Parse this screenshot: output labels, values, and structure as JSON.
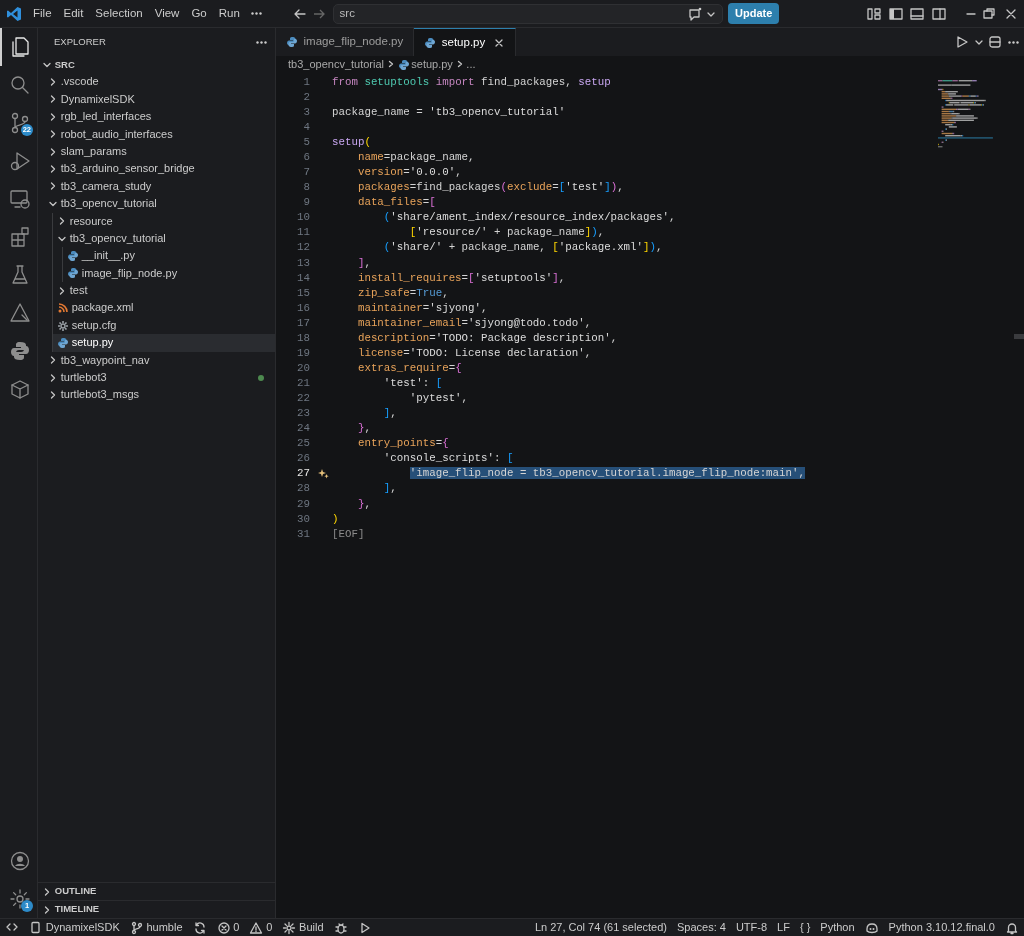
{
  "title_bar": {
    "menus": [
      "File",
      "Edit",
      "Selection",
      "View",
      "Go",
      "Run"
    ],
    "command_center": {
      "value": "src"
    },
    "update_button": "Update"
  },
  "activity_bar": {
    "top": [
      {
        "kind": "files",
        "selected": true
      },
      {
        "kind": "search",
        "selected": false
      },
      {
        "kind": "source-control",
        "selected": false,
        "badge": "22"
      },
      {
        "kind": "run-debug",
        "selected": false
      },
      {
        "kind": "remote",
        "selected": false
      },
      {
        "kind": "extensions",
        "selected": false
      },
      {
        "kind": "flask",
        "selected": false
      },
      {
        "kind": "tool",
        "selected": false
      },
      {
        "kind": "python",
        "selected": false
      },
      {
        "kind": "cube",
        "selected": false
      }
    ],
    "bottom": [
      {
        "kind": "account",
        "selected": false
      },
      {
        "kind": "settings",
        "selected": false,
        "badge": "1"
      }
    ]
  },
  "sidebar": {
    "title": "EXPLORER",
    "root": {
      "label": "SRC",
      "expanded": true
    },
    "tree": [
      {
        "label": ".vscode",
        "kind": "folder",
        "expanded": false,
        "selected": false
      },
      {
        "label": "DynamixelSDK",
        "kind": "folder",
        "expanded": false,
        "selected": false
      },
      {
        "label": "rgb_led_interfaces",
        "kind": "folder",
        "expanded": false,
        "selected": false
      },
      {
        "label": "robot_audio_interfaces",
        "kind": "folder",
        "expanded": false,
        "selected": false
      },
      {
        "label": "slam_params",
        "kind": "folder",
        "expanded": false,
        "selected": false
      },
      {
        "label": "tb3_arduino_sensor_bridge",
        "kind": "folder",
        "expanded": false,
        "selected": false
      },
      {
        "label": "tb3_camera_study",
        "kind": "folder",
        "expanded": false,
        "selected": false
      },
      {
        "label": "tb3_opencv_tutorial",
        "kind": "folder",
        "expanded": true,
        "selected": false,
        "children": [
          {
            "label": "resource",
            "kind": "folder",
            "expanded": false,
            "selected": false
          },
          {
            "label": "tb3_opencv_tutorial",
            "kind": "folder",
            "expanded": true,
            "selected": false,
            "children": [
              {
                "label": "__init__.py",
                "kind": "python",
                "selected": false
              },
              {
                "label": "image_flip_node.py",
                "kind": "python",
                "selected": false
              }
            ]
          },
          {
            "label": "test",
            "kind": "folder",
            "expanded": false,
            "selected": false
          },
          {
            "label": "package.xml",
            "kind": "xml",
            "selected": false
          },
          {
            "label": "setup.cfg",
            "kind": "config",
            "selected": false
          },
          {
            "label": "setup.py",
            "kind": "python",
            "selected": true
          }
        ]
      },
      {
        "label": "tb3_waypoint_nav",
        "kind": "folder",
        "expanded": false,
        "selected": false
      },
      {
        "label": "turtlebot3",
        "kind": "folder",
        "expanded": false,
        "selected": false,
        "color": "#4d8a4f"
      },
      {
        "label": "turtlebot3_msgs",
        "kind": "folder",
        "expanded": false,
        "selected": false
      }
    ],
    "panels": [
      {
        "label": "OUTLINE",
        "expanded": false
      },
      {
        "label": "TIMELINE",
        "expanded": false
      }
    ]
  },
  "tabs": [
    {
      "label": "image_flip_node.py",
      "selected": false
    },
    {
      "label": "setup.py",
      "selected": true
    }
  ],
  "breadcrumb": [
    "tb3_opencv_tutorial",
    "setup.py",
    "..."
  ],
  "code": [
    {
      "n": "1",
      "current": false,
      "tokens": [
        {
          "text": "from ",
          "kind": "kw"
        },
        {
          "text": "setuptools ",
          "kind": "mod"
        },
        {
          "text": "import",
          "kind": "kw"
        },
        {
          "text": " find_packages, ",
          "kind": "p"
        },
        {
          "text": "setup",
          "kind": "fn"
        }
      ]
    },
    {
      "n": "2",
      "current": false
    },
    {
      "n": "3",
      "current": false,
      "tokens": [
        {
          "text": "package_name = ",
          "kind": "p"
        },
        {
          "text": "'tb3_opencv_tutorial'",
          "kind": "s"
        }
      ]
    },
    {
      "n": "4",
      "current": false
    },
    {
      "n": "5",
      "current": false,
      "tokens": [
        {
          "text": "setup",
          "kind": "fn"
        },
        {
          "text": "(",
          "kind": "b1"
        }
      ]
    },
    {
      "n": "6",
      "current": false,
      "tokens": [
        {
          "text": "    name",
          "kind": "arg"
        },
        {
          "text": "=package_name,",
          "kind": "p"
        }
      ]
    },
    {
      "n": "7",
      "current": false,
      "tokens": [
        {
          "text": "    version",
          "kind": "arg"
        },
        {
          "text": "=",
          "kind": "p"
        },
        {
          "text": "'0.0.0'",
          "kind": "s"
        },
        {
          "text": ",",
          "kind": "p"
        }
      ]
    },
    {
      "n": "8",
      "current": false,
      "tokens": [
        {
          "text": "    packages",
          "kind": "arg"
        },
        {
          "text": "=find_packages",
          "kind": "p"
        },
        {
          "text": "(",
          "kind": "b2"
        },
        {
          "text": "exclude",
          "kind": "arg"
        },
        {
          "text": "=",
          "kind": "p"
        },
        {
          "text": "[",
          "kind": "b3"
        },
        {
          "text": "'test'",
          "kind": "s"
        },
        {
          "text": "]",
          "kind": "b3"
        },
        {
          "text": ")",
          "kind": "b2"
        },
        {
          "text": ",",
          "kind": "p"
        }
      ]
    },
    {
      "n": "9",
      "current": false,
      "tokens": [
        {
          "text": "    data_files",
          "kind": "arg"
        },
        {
          "text": "=",
          "kind": "p"
        },
        {
          "text": "[",
          "kind": "b2"
        }
      ]
    },
    {
      "n": "10",
      "current": false,
      "tokens": [
        {
          "text": "        (",
          "kind": "b3"
        },
        {
          "text": "'share/ament_index/resource_index/packages'",
          "kind": "s"
        },
        {
          "text": ",",
          "kind": "p"
        }
      ]
    },
    {
      "n": "11",
      "current": false,
      "tokens": [
        {
          "text": "            [",
          "kind": "b1"
        },
        {
          "text": "'resource/'",
          "kind": "s"
        },
        {
          "text": " + package_name",
          "kind": "p"
        },
        {
          "text": "]",
          "kind": "b1"
        },
        {
          "text": ")",
          "kind": "b3"
        },
        {
          "text": ",",
          "kind": "p"
        }
      ]
    },
    {
      "n": "12",
      "current": false,
      "tokens": [
        {
          "text": "        (",
          "kind": "b3"
        },
        {
          "text": "'share/'",
          "kind": "s"
        },
        {
          "text": " + package_name, ",
          "kind": "p"
        },
        {
          "text": "[",
          "kind": "b1"
        },
        {
          "text": "'package.xml'",
          "kind": "s"
        },
        {
          "text": "]",
          "kind": "b1"
        },
        {
          "text": ")",
          "kind": "b3"
        },
        {
          "text": ",",
          "kind": "p"
        }
      ]
    },
    {
      "n": "13",
      "current": false,
      "tokens": [
        {
          "text": "    ]",
          "kind": "b2"
        },
        {
          "text": ",",
          "kind": "p"
        }
      ]
    },
    {
      "n": "14",
      "current": false,
      "tokens": [
        {
          "text": "    install_requires",
          "kind": "arg"
        },
        {
          "text": "=",
          "kind": "p"
        },
        {
          "text": "[",
          "kind": "b2"
        },
        {
          "text": "'setuptools'",
          "kind": "s"
        },
        {
          "text": "]",
          "kind": "b2"
        },
        {
          "text": ",",
          "kind": "p"
        }
      ]
    },
    {
      "n": "15",
      "current": false,
      "tokens": [
        {
          "text": "    zip_safe",
          "kind": "arg"
        },
        {
          "text": "=",
          "kind": "p"
        },
        {
          "text": "True",
          "kind": "const"
        },
        {
          "text": ",",
          "kind": "p"
        }
      ]
    },
    {
      "n": "16",
      "current": false,
      "tokens": [
        {
          "text": "    maintainer",
          "kind": "arg"
        },
        {
          "text": "=",
          "kind": "p"
        },
        {
          "text": "'sjyong'",
          "kind": "s"
        },
        {
          "text": ",",
          "kind": "p"
        }
      ]
    },
    {
      "n": "17",
      "current": false,
      "tokens": [
        {
          "text": "    maintainer_email",
          "kind": "arg"
        },
        {
          "text": "=",
          "kind": "p"
        },
        {
          "text": "'sjyong@todo.todo'",
          "kind": "s"
        },
        {
          "text": ",",
          "kind": "p"
        }
      ]
    },
    {
      "n": "18",
      "current": false,
      "tokens": [
        {
          "text": "    description",
          "kind": "arg"
        },
        {
          "text": "=",
          "kind": "p"
        },
        {
          "text": "'TODO: Package description'",
          "kind": "s"
        },
        {
          "text": ",",
          "kind": "p"
        }
      ]
    },
    {
      "n": "19",
      "current": false,
      "tokens": [
        {
          "text": "    license",
          "kind": "arg"
        },
        {
          "text": "=",
          "kind": "p"
        },
        {
          "text": "'TODO: License declaration'",
          "kind": "s"
        },
        {
          "text": ",",
          "kind": "p"
        }
      ]
    },
    {
      "n": "20",
      "current": false,
      "tokens": [
        {
          "text": "    extras_require",
          "kind": "arg"
        },
        {
          "text": "=",
          "kind": "p"
        },
        {
          "text": "{",
          "kind": "b2"
        }
      ]
    },
    {
      "n": "21",
      "current": false,
      "tokens": [
        {
          "text": "        'test'",
          "kind": "s"
        },
        {
          "text": ": ",
          "kind": "p"
        },
        {
          "text": "[",
          "kind": "b3"
        }
      ]
    },
    {
      "n": "22",
      "current": false,
      "tokens": [
        {
          "text": "            'pytest'",
          "kind": "s"
        },
        {
          "text": ",",
          "kind": "p"
        }
      ]
    },
    {
      "n": "23",
      "current": false,
      "tokens": [
        {
          "text": "        ]",
          "kind": "b3"
        },
        {
          "text": ",",
          "kind": "p"
        }
      ]
    },
    {
      "n": "24",
      "current": false,
      "tokens": [
        {
          "text": "    }",
          "kind": "b2"
        },
        {
          "text": ",",
          "kind": "p"
        }
      ]
    },
    {
      "n": "25",
      "current": false,
      "tokens": [
        {
          "text": "    entry_points",
          "kind": "arg"
        },
        {
          "text": "=",
          "kind": "p"
        },
        {
          "text": "{",
          "kind": "b2"
        }
      ]
    },
    {
      "n": "26",
      "current": false,
      "tokens": [
        {
          "text": "        'console_scripts'",
          "kind": "s"
        },
        {
          "text": ": ",
          "kind": "p"
        },
        {
          "text": "[",
          "kind": "b3"
        }
      ]
    },
    {
      "n": "27",
      "current": true,
      "tokens": [
        {
          "text": "'image_flip_node = tb3_opencv_tutorial.image_flip_node:main',",
          "kind": "sel"
        }
      ]
    },
    {
      "n": "28",
      "current": false,
      "tokens": [
        {
          "text": "        ]",
          "kind": "b3"
        },
        {
          "text": ",",
          "kind": "p"
        }
      ]
    },
    {
      "n": "29",
      "current": false,
      "tokens": [
        {
          "text": "    }",
          "kind": "b2"
        },
        {
          "text": ",",
          "kind": "p"
        }
      ]
    },
    {
      "n": "30",
      "current": false,
      "tokens": [
        {
          "text": ")",
          "kind": "b1"
        }
      ]
    },
    {
      "n": "31",
      "current": false,
      "tokens": [
        {
          "text": "[EOF]",
          "kind": "eof"
        }
      ]
    }
  ],
  "status_bar": {
    "left": [
      {
        "kind": "remote"
      },
      {
        "kind": "device",
        "text": "DynamixelSDK"
      },
      {
        "kind": "branch",
        "text": "humble"
      },
      {
        "kind": "sync"
      },
      {
        "kind": "error",
        "text": "0"
      },
      {
        "kind": "warning",
        "text": "0"
      },
      {
        "kind": "gear",
        "text": "Build"
      },
      {
        "kind": "bug"
      },
      {
        "kind": "play"
      }
    ],
    "right": [
      {
        "kind": "text",
        "text": "Ln 27, Col 74 (61 selected)"
      },
      {
        "kind": "text",
        "text": "Spaces: 4"
      },
      {
        "kind": "text",
        "text": "UTF-8"
      },
      {
        "kind": "text",
        "text": "LF"
      },
      {
        "kind": "text",
        "text": "{ }"
      },
      {
        "kind": "text",
        "text": "Python"
      },
      {
        "kind": "copilot"
      },
      {
        "kind": "text",
        "text": "Python 3.10.12.final.0"
      },
      {
        "kind": "bell"
      }
    ]
  }
}
